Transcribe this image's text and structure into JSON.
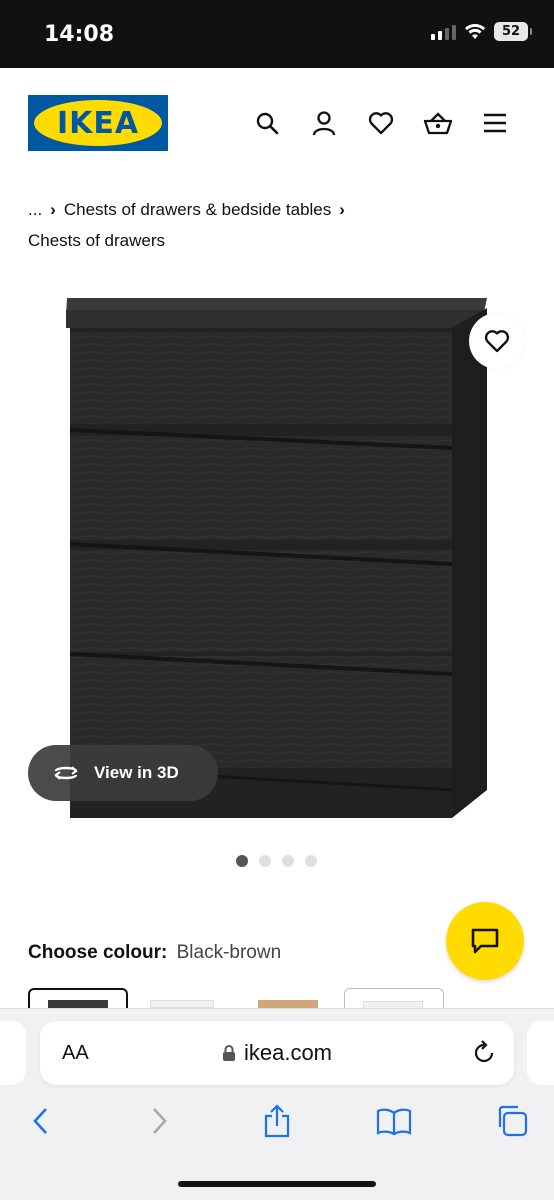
{
  "status_bar": {
    "time": "14:08",
    "battery": "52"
  },
  "header": {
    "logo_text": "IKEA",
    "icons": [
      "search-icon",
      "account-icon",
      "heart-icon",
      "basket-icon",
      "menu-icon"
    ]
  },
  "breadcrumb": {
    "ellipsis": "...",
    "parent": "Chests of drawers & bedside tables",
    "current": "Chests of drawers"
  },
  "product": {
    "view_3d_label": "View in 3D",
    "image_count": 4,
    "active_image": 1
  },
  "colour": {
    "label": "Choose colour:",
    "value": "Black-brown"
  },
  "browser": {
    "aa_label": "AA",
    "url": "ikea.com"
  },
  "colors": {
    "ikea_blue": "#0058a3",
    "ikea_yellow": "#ffdb00"
  }
}
